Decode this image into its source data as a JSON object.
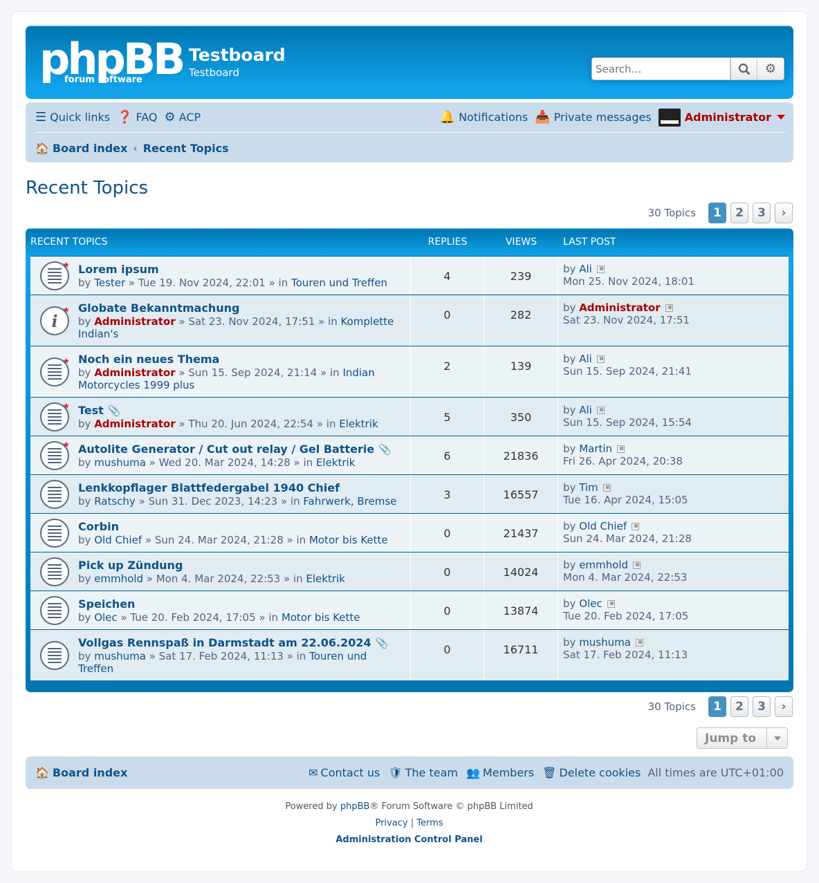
{
  "header": {
    "logo_main": "phpBB",
    "logo_sub": "forum  software",
    "site_title": "Testboard",
    "site_description": "Testboard",
    "search_placeholder": "Search…"
  },
  "navbar": {
    "quick_links": "Quick links",
    "faq": "FAQ",
    "acp": "ACP",
    "notifications": "Notifications",
    "private_messages": "Private messages",
    "username": "Administrator",
    "breadcrumb_home": "Board index",
    "breadcrumb_current": "Recent Topics"
  },
  "page_title": "Recent Topics",
  "pagination": {
    "count": "30 Topics",
    "pages": [
      "1",
      "2",
      "3"
    ],
    "next": "›"
  },
  "table": {
    "headers": {
      "topics": "RECENT TOPICS",
      "replies": "REPLIES",
      "views": "VIEWS",
      "last_post": "LAST POST"
    },
    "rows": [
      {
        "title": "Lorem ipsum",
        "by": "by",
        "author": "Tester",
        "date": "» Tue 19. Nov 2024, 22:01 » in",
        "forum": "Touren und Treffen",
        "replies": "4",
        "views": "239",
        "last_by": "Ali",
        "last_date": "Mon 25. Nov 2024, 18:01"
      },
      {
        "title": "Globate Bekanntmachung",
        "by": "by",
        "author": "Administrator",
        "date": "» Sat 23. Nov 2024, 17:51 » in",
        "forum": "Komplette Indian's",
        "replies": "0",
        "views": "282",
        "last_by": "Administrator",
        "last_date": "Sat 23. Nov 2024, 17:51"
      },
      {
        "title": "Noch ein neues Thema",
        "by": "by",
        "author": "Administrator",
        "date": "» Sun 15. Sep 2024, 21:14 » in",
        "forum": "Indian Motorcycles 1999 plus",
        "replies": "2",
        "views": "139",
        "last_by": "Ali",
        "last_date": "Sun 15. Sep 2024, 21:41"
      },
      {
        "title": "Test",
        "by": "by",
        "author": "Administrator",
        "date": "» Thu 20. Jun 2024, 22:54 » in",
        "forum": "Elektrik",
        "replies": "5",
        "views": "350",
        "last_by": "Ali",
        "last_date": "Sun 15. Sep 2024, 15:54"
      },
      {
        "title": "Autolite Generator / Cut out relay / Gel Batterie",
        "by": "by",
        "author": "mushuma",
        "date": "» Wed 20. Mar 2024, 14:28 » in",
        "forum": "Elektrik",
        "replies": "6",
        "views": "21836",
        "last_by": "Martin",
        "last_date": "Fri 26. Apr 2024, 20:38"
      },
      {
        "title": "Lenkkopflager Blattfedergabel 1940 Chief",
        "by": "by",
        "author": "Ratschy",
        "date": "» Sun 31. Dec 2023, 14:23 » in",
        "forum": "Fahrwerk, Bremse",
        "replies": "3",
        "views": "16557",
        "last_by": "Tim",
        "last_date": "Tue 16. Apr 2024, 15:05"
      },
      {
        "title": "Corbin",
        "by": "by",
        "author": "Old Chief",
        "date": "» Sun 24. Mar 2024, 21:28 » in",
        "forum": "Motor bis Kette",
        "replies": "0",
        "views": "21437",
        "last_by": "Old Chief",
        "last_date": "Sun 24. Mar 2024, 21:28"
      },
      {
        "title": "Pick up Zündung",
        "by": "by",
        "author": "emmhold",
        "date": "» Mon 4. Mar 2024, 22:53 » in",
        "forum": "Elektrik",
        "replies": "0",
        "views": "14024",
        "last_by": "emmhold",
        "last_date": "Mon 4. Mar 2024, 22:53"
      },
      {
        "title": "Speichen",
        "by": "by",
        "author": "Olec",
        "date": "» Tue 20. Feb 2024, 17:05 » in",
        "forum": "Motor bis Kette",
        "replies": "0",
        "views": "13874",
        "last_by": "Olec",
        "last_date": "Tue 20. Feb 2024, 17:05"
      },
      {
        "title": "Vollgas Rennspaß in Darmstadt am 22.06.2024",
        "by": "by",
        "author": "mushuma",
        "date": "» Sat 17. Feb 2024, 11:13 » in",
        "forum": "Touren und Treffen",
        "replies": "0",
        "views": "16711",
        "last_by": "mushuma",
        "last_date": "Sat 17. Feb 2024, 11:13"
      }
    ]
  },
  "jump_to": "Jump to",
  "footer": {
    "board_index": "Board index",
    "contact": "Contact us",
    "team": "The team",
    "members": "Members",
    "delete_cookies": "Delete cookies",
    "timezone": "All times are UTC+01:00",
    "powered_prefix": "Powered by",
    "powered_link": "phpBB",
    "powered_suffix": "® Forum Software © phpBB Limited",
    "privacy": "Privacy",
    "sep": "|",
    "terms": "Terms",
    "acp_link": "Administration Control Panel"
  }
}
